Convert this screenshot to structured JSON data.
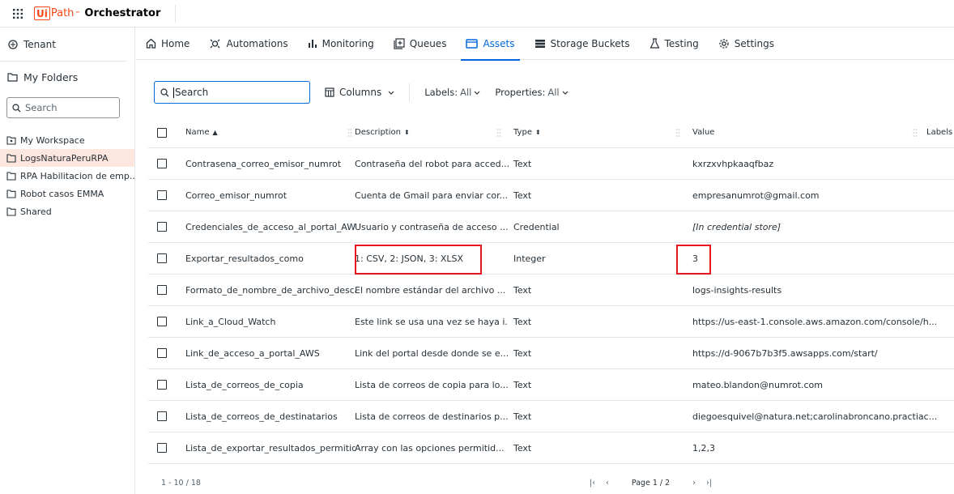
{
  "header": {
    "logo_box": "Ui",
    "logo_path": "Path",
    "logo_tm": "™",
    "product": "Orchestrator"
  },
  "sidebar": {
    "tenant": "Tenant",
    "my_folders": "My Folders",
    "search_placeholder": "Search",
    "folders": [
      {
        "label": "My Workspace",
        "active": false
      },
      {
        "label": "LogsNaturaPeruRPA",
        "active": true
      },
      {
        "label": "RPA Habilitacion de emp...",
        "active": false
      },
      {
        "label": "Robot casos EMMA",
        "active": false
      },
      {
        "label": "Shared",
        "active": false
      }
    ]
  },
  "nav": {
    "tabs": [
      {
        "label": "Home",
        "icon": "home-icon"
      },
      {
        "label": "Automations",
        "icon": "automations-icon"
      },
      {
        "label": "Monitoring",
        "icon": "monitoring-icon"
      },
      {
        "label": "Queues",
        "icon": "queues-icon"
      },
      {
        "label": "Assets",
        "icon": "assets-icon",
        "active": true
      },
      {
        "label": "Storage Buckets",
        "icon": "storage-icon"
      },
      {
        "label": "Testing",
        "icon": "testing-icon"
      },
      {
        "label": "Settings",
        "icon": "settings-icon"
      }
    ]
  },
  "toolbar": {
    "search_value": "Search",
    "columns": "Columns",
    "labels_key": "Labels:",
    "labels_val": "All",
    "properties_key": "Properties:",
    "properties_val": "All"
  },
  "table": {
    "headers": {
      "name": "Name",
      "description": "Description",
      "type": "Type",
      "value": "Value",
      "labels": "Labels"
    },
    "rows": [
      {
        "name": "Contrasena_correo_emisor_numrot",
        "description": "Contraseña del robot para acced...",
        "type": "Text",
        "value": "kxrzxvhpkaaqfbaz"
      },
      {
        "name": "Correo_emisor_numrot",
        "description": "Cuenta de Gmail para enviar cor...",
        "type": "Text",
        "value": "empresanumrot@gmail.com"
      },
      {
        "name": "Credenciales_de_acceso_al_portal_AWS",
        "description": "Usuario y contraseña de acceso ...",
        "type": "Credential",
        "value": "[In credential store]"
      },
      {
        "name": "Exportar_resultados_como",
        "description": "1: CSV, 2: JSON, 3: XLSX",
        "type": "Integer",
        "value": "3"
      },
      {
        "name": "Formato_de_nombre_de_archivo_desca...",
        "description": "El nombre estándar del archivo ...",
        "type": "Text",
        "value": "logs-insights-results"
      },
      {
        "name": "Link_a_Cloud_Watch",
        "description": "Este link se usa una vez se haya i...",
        "type": "Text",
        "value": "https://us-east-1.console.aws.amazon.com/console/h..."
      },
      {
        "name": "Link_de_acceso_a_portal_AWS",
        "description": "Link del portal desde donde se e...",
        "type": "Text",
        "value": "https://d-9067b7b3f5.awsapps.com/start/"
      },
      {
        "name": "Lista_de_correos_de_copia",
        "description": "Lista de correos de copia para lo...",
        "type": "Text",
        "value": "mateo.blandon@numrot.com"
      },
      {
        "name": "Lista_de_correos_de_destinatarios",
        "description": "Lista de correos de destinarios p...",
        "type": "Text",
        "value": "diegoesquivel@natura.net;carolinabroncano.practiac..."
      },
      {
        "name": "Lista_de_exportar_resultados_permitida",
        "description": "Array con las opciones permitid...",
        "type": "Text",
        "value": "1,2,3"
      }
    ]
  },
  "footer": {
    "range": "1 - 10 / 18",
    "first": "|‹",
    "prev": "‹",
    "page": "Page 1 / 2",
    "next": "›",
    "last": "›|"
  },
  "colors": {
    "accent": "#0067df",
    "brand": "#fa4616",
    "highlight": "#e8151f",
    "active_folder_bg": "#fde6de"
  }
}
